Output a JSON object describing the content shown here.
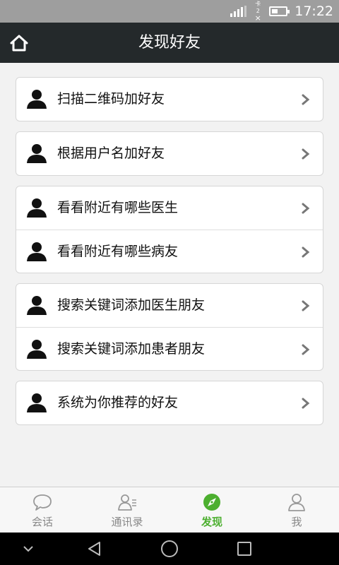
{
  "status_bar": {
    "time": "17:22",
    "sim_label": "卡2"
  },
  "header": {
    "title": "发现好友",
    "home_icon": "home-icon"
  },
  "groups": [
    {
      "items": [
        {
          "label": "扫描二维码加好友"
        }
      ]
    },
    {
      "items": [
        {
          "label": "根据用户名加好友"
        }
      ]
    },
    {
      "items": [
        {
          "label": "看看附近有哪些医生"
        },
        {
          "label": "看看附近有哪些病友"
        }
      ]
    },
    {
      "items": [
        {
          "label": "搜索关键词添加医生朋友"
        },
        {
          "label": "搜索关键词添加患者朋友"
        }
      ]
    },
    {
      "items": [
        {
          "label": "系统为你推荐的好友"
        }
      ]
    }
  ],
  "tabs": [
    {
      "label": "会话",
      "icon": "chat-bubble-icon",
      "active": false
    },
    {
      "label": "通讯录",
      "icon": "contacts-icon",
      "active": false
    },
    {
      "label": "发现",
      "icon": "compass-icon",
      "active": true
    },
    {
      "label": "我",
      "icon": "profile-icon",
      "active": false
    }
  ],
  "colors": {
    "accent": "#4caf2f",
    "header_bg": "#24292b",
    "status_bg": "#9e9e9e"
  }
}
